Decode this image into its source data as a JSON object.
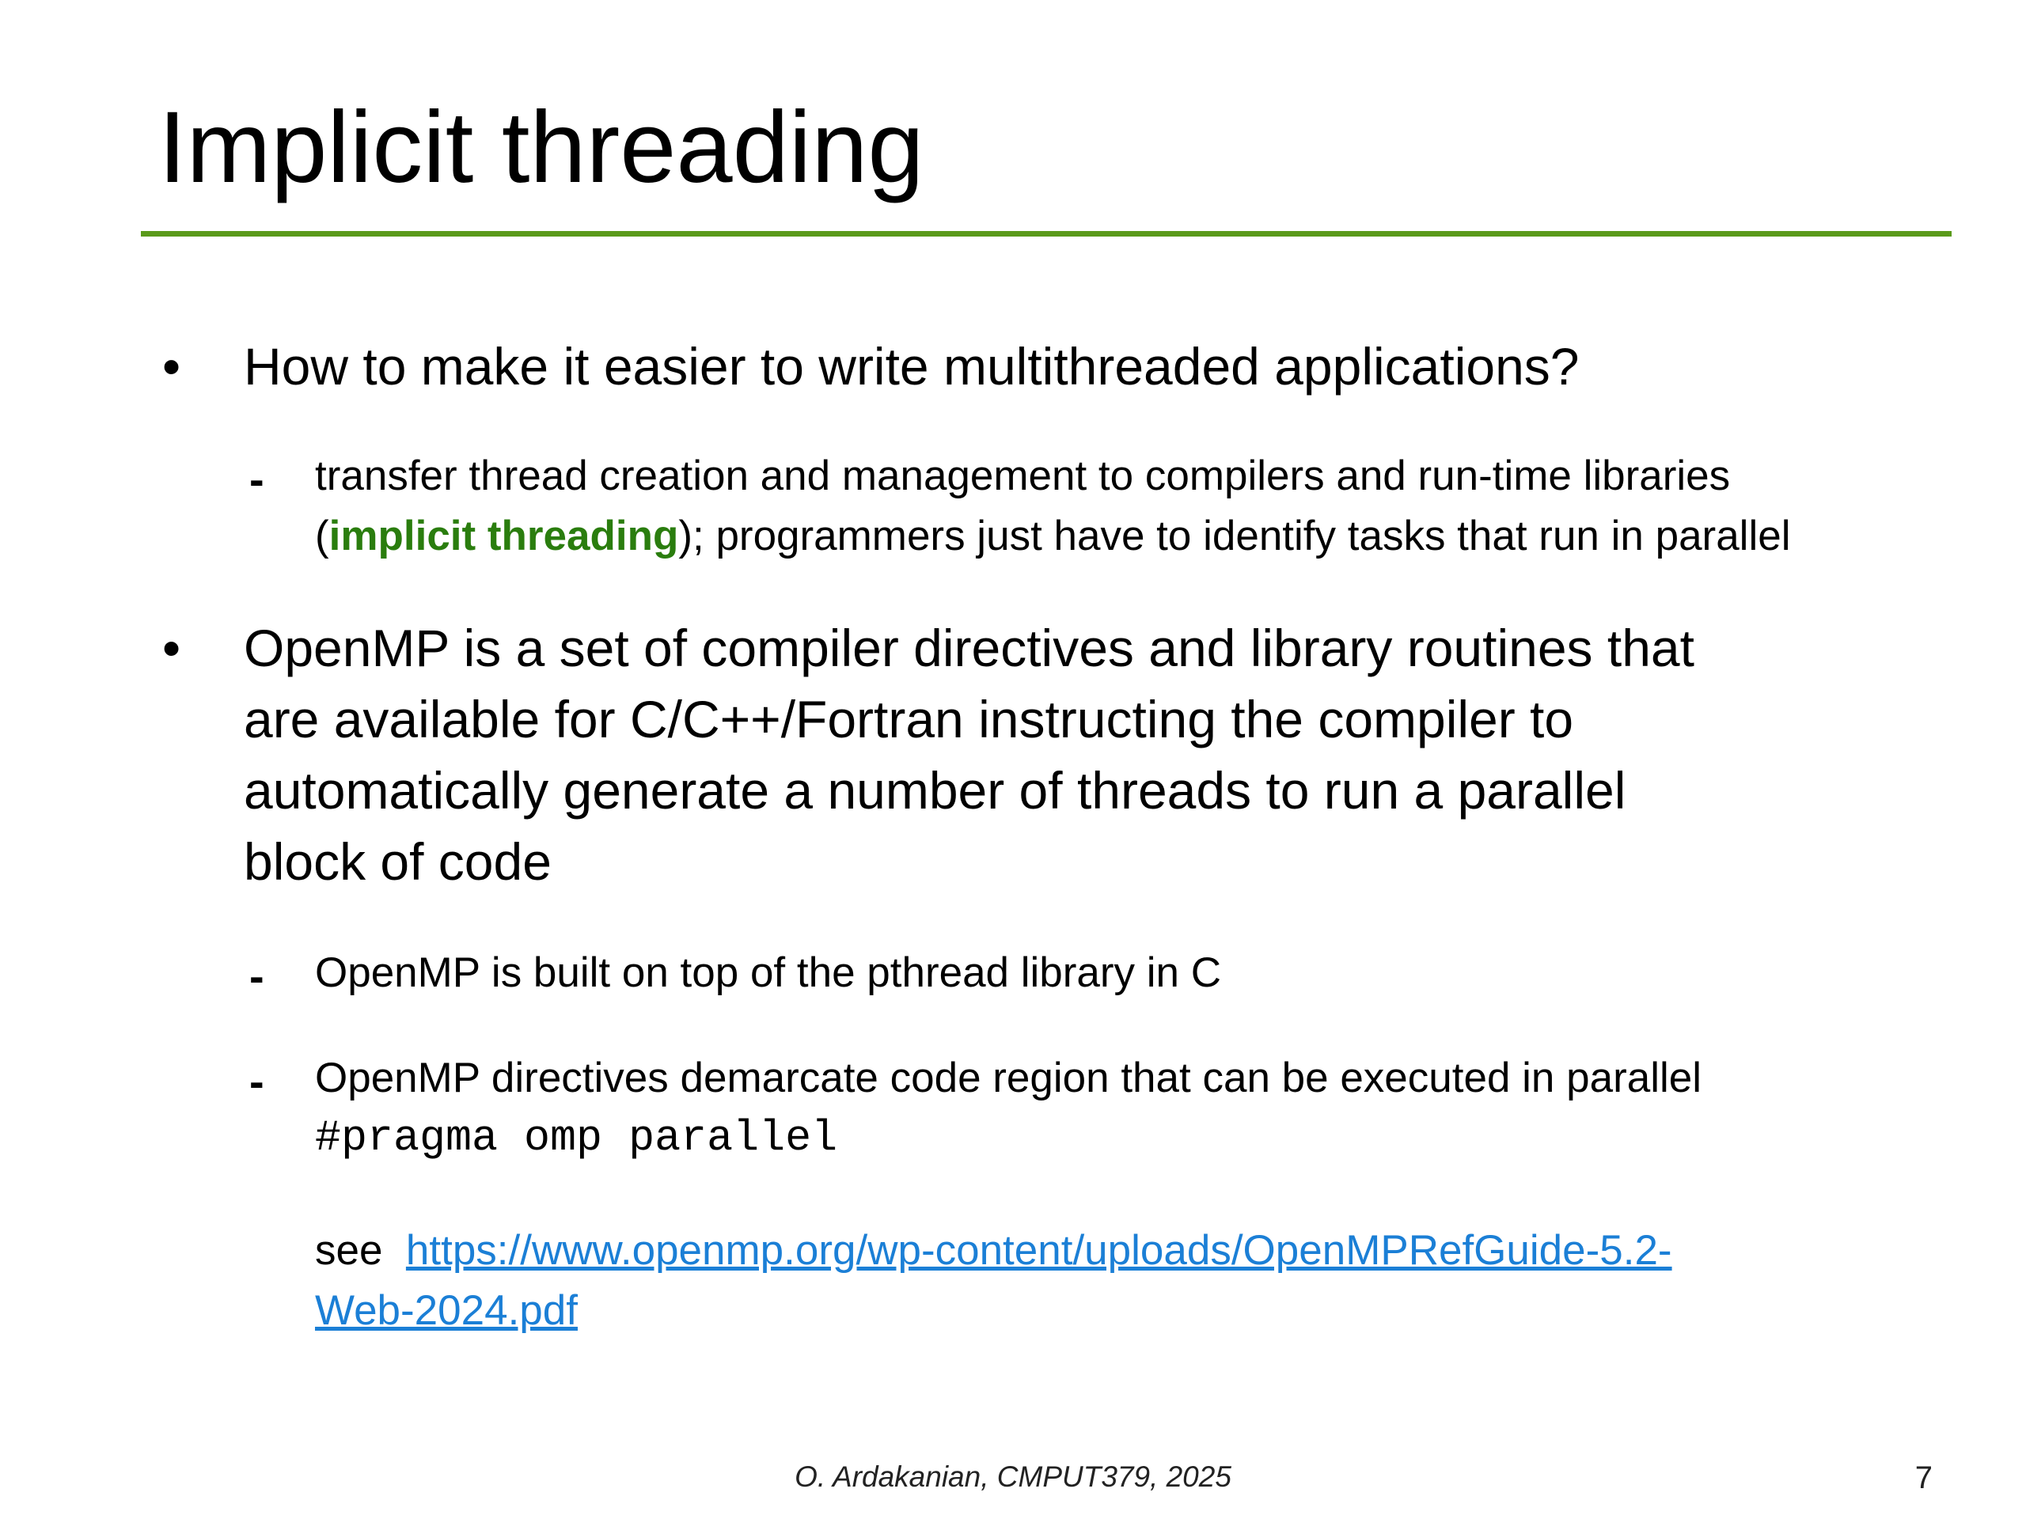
{
  "slide": {
    "title": "Implicit threading",
    "accent_color": "#5a9a1a",
    "bullet_symbol": "•",
    "dash_symbol": "-",
    "bullets": [
      {
        "text": "How to make it easier to write multithreaded applications?",
        "subs": [
          {
            "line1": "transfer thread creation and management to compilers and run-time libraries",
            "line2_open": "(",
            "line2_highlight": "implicit threading",
            "line2_rest": "); programmers just have to identify tasks that run in parallel"
          }
        ]
      },
      {
        "lines": [
          "OpenMP is a set of compiler directives and library routines that",
          "are available for C/C++/Fortran instructing the compiler to",
          "automatically generate a number of threads to run a parallel",
          "block of code"
        ],
        "subs": [
          {
            "text": "OpenMP is built on top of the pthread library in C"
          },
          {
            "text": "OpenMP directives demarcate code region that can be executed in parallel",
            "code": "#pragma omp parallel",
            "see_label": "see",
            "link_line1": "https://www.openmp.org/wp-content/uploads/OpenMPRefGuide-5.2-",
            "link_line2": "Web-2024.pdf"
          }
        ]
      }
    ]
  },
  "footer": {
    "credit": "O. Ardakanian, CMPUT379, 2025",
    "page_number": "7"
  }
}
